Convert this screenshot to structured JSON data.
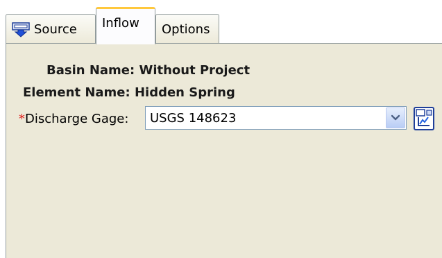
{
  "tabs": [
    {
      "label": "Source",
      "icon": "source-icon"
    },
    {
      "label": "Inflow",
      "active": true
    },
    {
      "label": "Options"
    }
  ],
  "form": {
    "basin_name_label": "Basin Name: Without Project",
    "element_name_label": "Element Name: Hidden Spring",
    "required_marker": "*",
    "discharge_gage_label": "Discharge Gage:",
    "discharge_gage_value": "USGS 148623",
    "dropdown_icon": "chevron-down-icon",
    "gage_manager_icon": "gage-manager-icon"
  },
  "colors": {
    "panel_bg": "#ece9d8",
    "active_tab_accent": "#ffc83c",
    "required": "#e0201c",
    "dropdown_button": "#b9cdf5"
  }
}
